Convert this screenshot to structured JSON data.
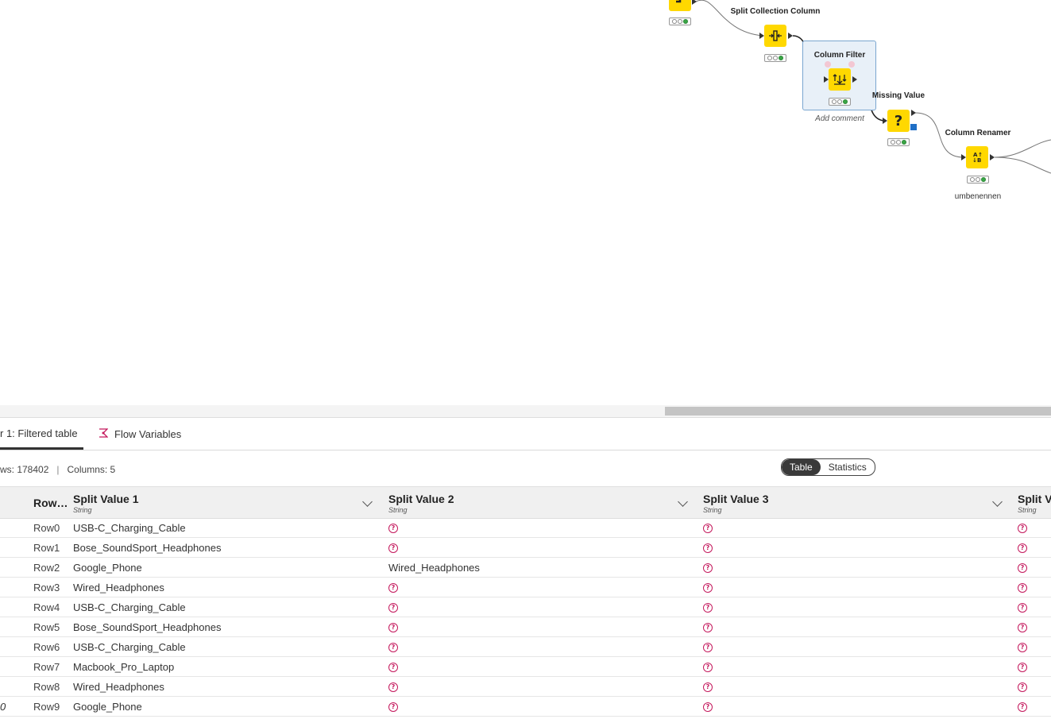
{
  "workflow": {
    "nodes": {
      "split_collection": {
        "title": "Split Collection Column"
      },
      "column_filter": {
        "title": "Column Filter",
        "comment": "Add comment"
      },
      "missing_value": {
        "title": "Missing Value"
      },
      "column_renamer": {
        "title": "Column Renamer",
        "comment": "umbenennen"
      }
    },
    "icons": {
      "split_collection": "split-collection-icon",
      "column_filter": "column-filter-icon",
      "missing_value": "missing-value-icon",
      "column_renamer": "column-renamer-icon"
    },
    "node_color": "#ffd800"
  },
  "tabs": {
    "output": "r 1: Filtered table",
    "flow_variables": "Flow Variables"
  },
  "info": {
    "rows": "ws: 178402",
    "separator": "|",
    "columns": "Columns: 5"
  },
  "view_toggle": {
    "table": "Table",
    "statistics": "Statistics",
    "selected": "Table"
  },
  "table": {
    "headers": [
      {
        "name": "Row…",
        "type": ""
      },
      {
        "name": "Split Value 1",
        "type": "String"
      },
      {
        "name": "Split Value 2",
        "type": "String"
      },
      {
        "name": "Split Value 3",
        "type": "String"
      },
      {
        "name": "Split V",
        "type": "String"
      }
    ],
    "rows": [
      {
        "index": "",
        "id": "Row0",
        "v1": "USB-C_Charging_Cable",
        "v2": null,
        "v3": null,
        "v4": null
      },
      {
        "index": "",
        "id": "Row1",
        "v1": "Bose_SoundSport_Headphones",
        "v2": null,
        "v3": null,
        "v4": null
      },
      {
        "index": "",
        "id": "Row2",
        "v1": "Google_Phone",
        "v2": "Wired_Headphones",
        "v3": null,
        "v4": null
      },
      {
        "index": "",
        "id": "Row3",
        "v1": "Wired_Headphones",
        "v2": null,
        "v3": null,
        "v4": null
      },
      {
        "index": "",
        "id": "Row4",
        "v1": "USB-C_Charging_Cable",
        "v2": null,
        "v3": null,
        "v4": null
      },
      {
        "index": "",
        "id": "Row5",
        "v1": "Bose_SoundSport_Headphones",
        "v2": null,
        "v3": null,
        "v4": null
      },
      {
        "index": "",
        "id": "Row6",
        "v1": "USB-C_Charging_Cable",
        "v2": null,
        "v3": null,
        "v4": null
      },
      {
        "index": "",
        "id": "Row7",
        "v1": "Macbook_Pro_Laptop",
        "v2": null,
        "v3": null,
        "v4": null
      },
      {
        "index": "",
        "id": "Row8",
        "v1": "Wired_Headphones",
        "v2": null,
        "v3": null,
        "v4": null
      },
      {
        "index": "0",
        "id": "Row9",
        "v1": "Google_Phone",
        "v2": null,
        "v3": null,
        "v4": null
      }
    ],
    "missing_symbol": "?",
    "missing_color": "#c4185c"
  }
}
